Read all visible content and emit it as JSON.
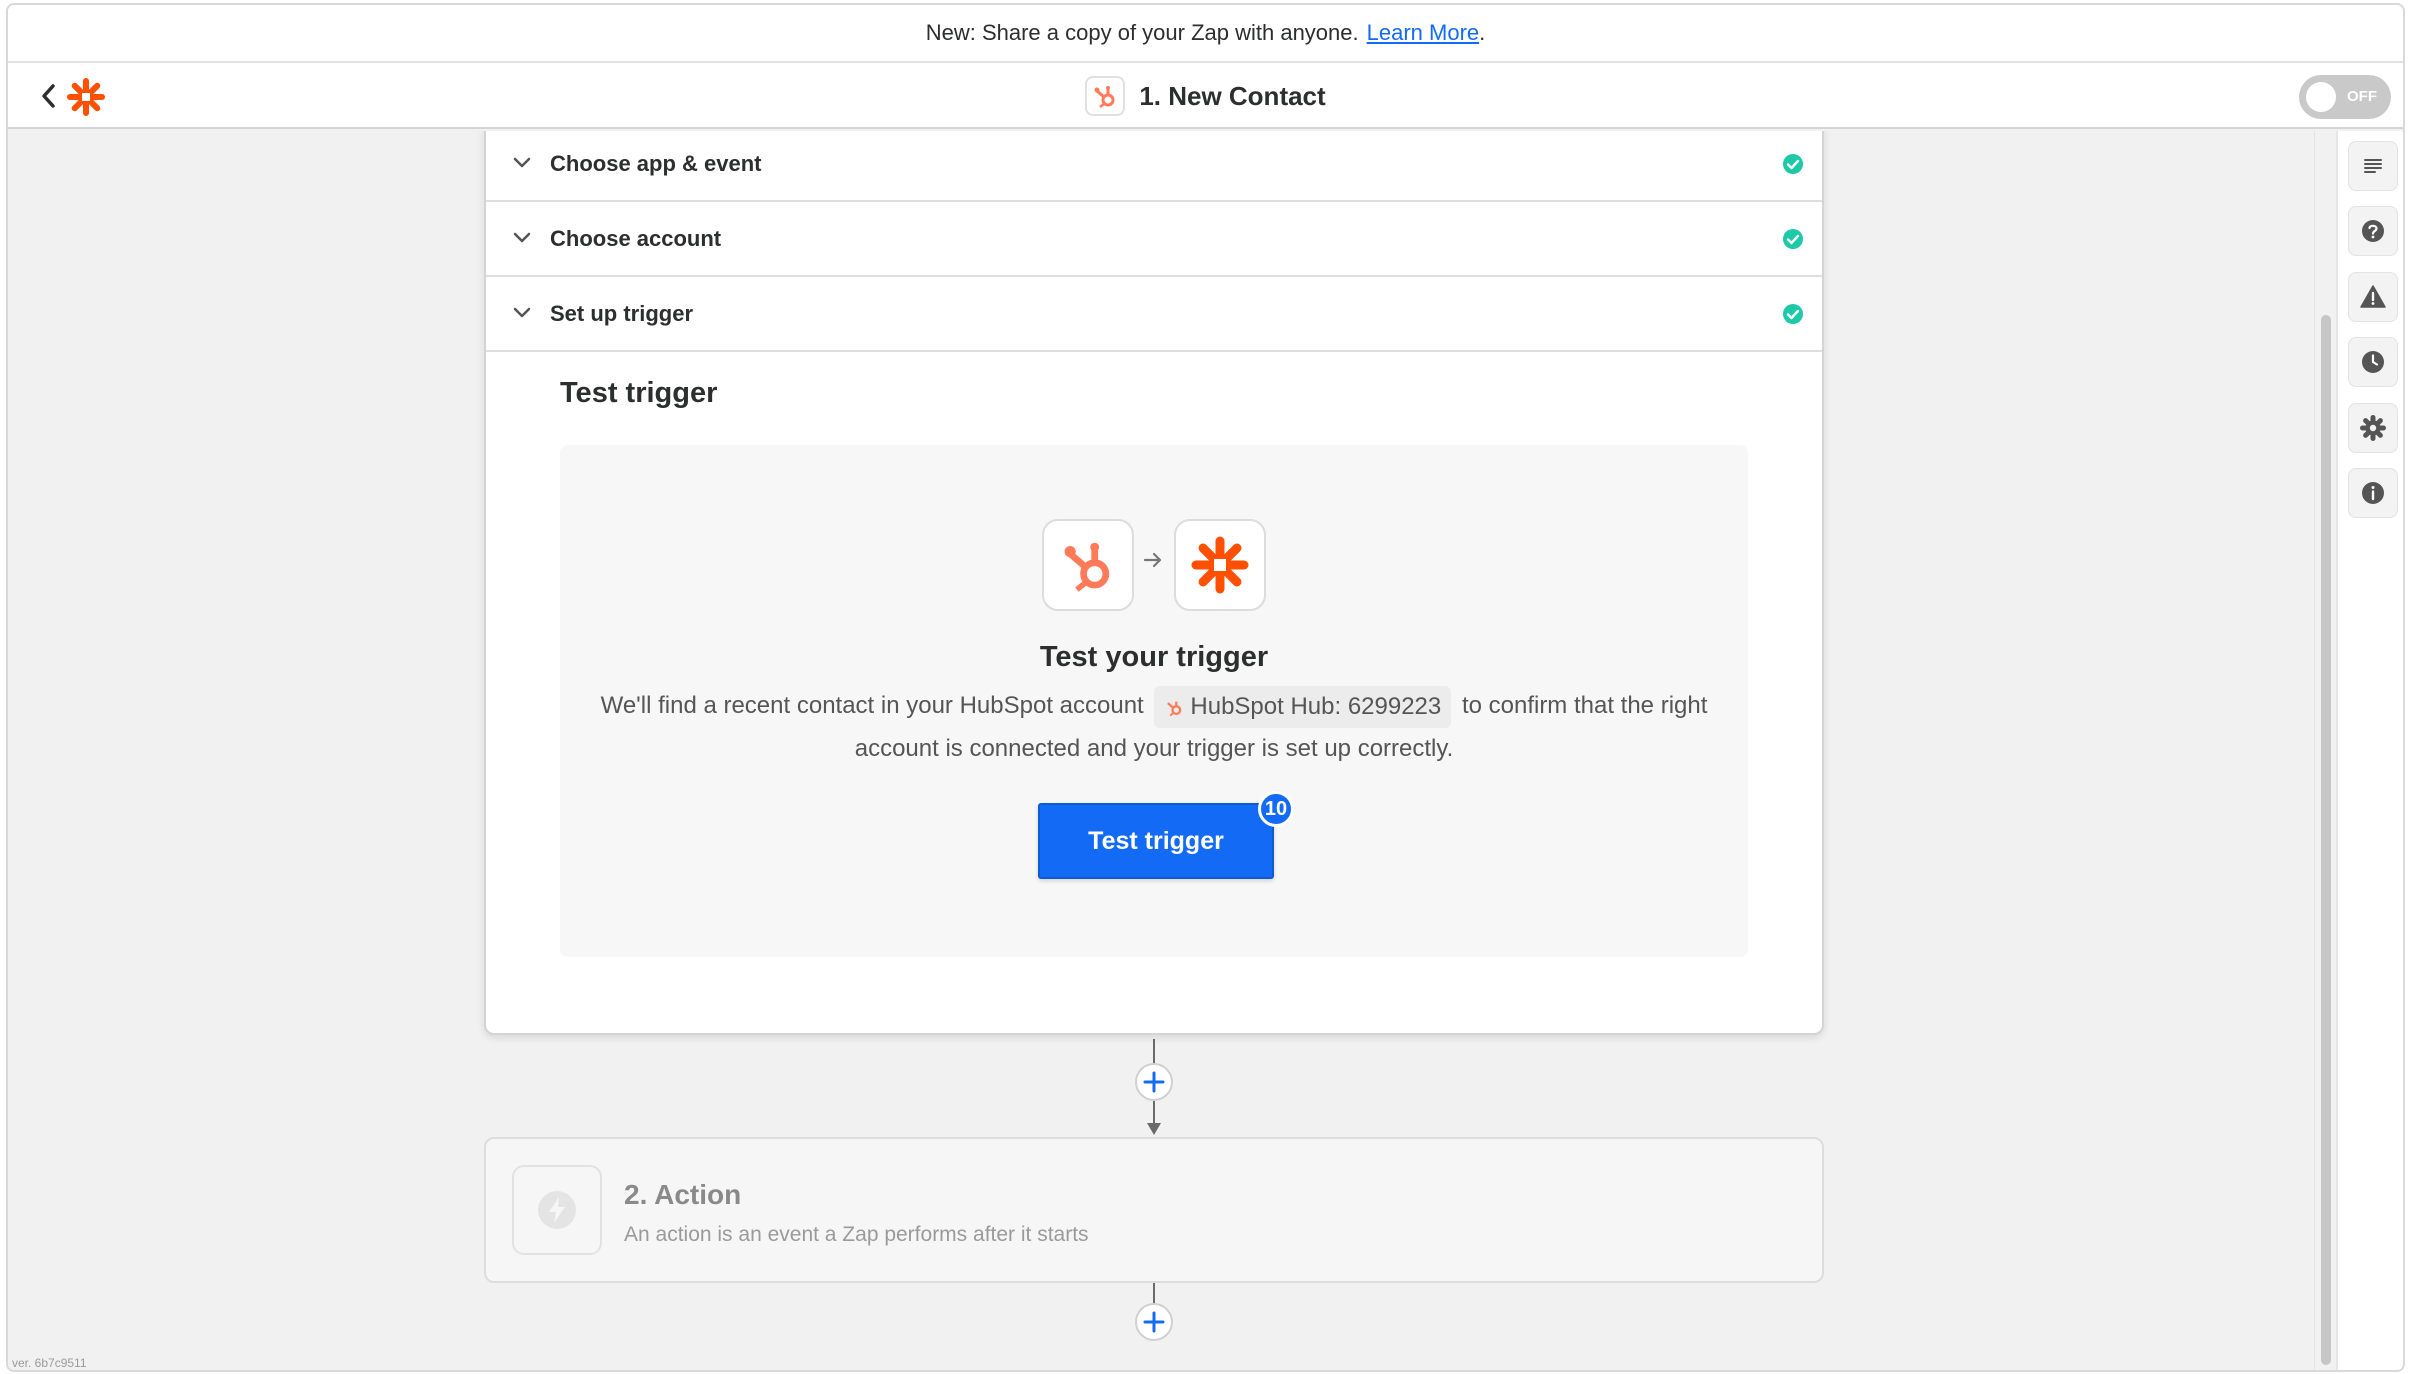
{
  "banner": {
    "text": "New: Share a copy of your Zap with anyone.",
    "link": "Learn More",
    "suffix": "."
  },
  "header": {
    "title": "1. New Contact",
    "toggle_label": "OFF"
  },
  "accordion": [
    {
      "label": "Choose app & event",
      "status": "complete"
    },
    {
      "label": "Choose account",
      "status": "complete"
    },
    {
      "label": "Set up trigger",
      "status": "complete"
    }
  ],
  "test": {
    "heading": "Test trigger",
    "panel_title": "Test your trigger",
    "desc_before": "We'll find a recent contact in your HubSpot account",
    "chip": "HubSpot Hub: 6299223",
    "desc_after": "to confirm that the right account is connected and your trigger is set up correctly.",
    "button": "Test trigger",
    "badge": "10"
  },
  "action": {
    "title": "2. Action",
    "subtitle": "An action is an event a Zap performs after it starts"
  },
  "version": "ver. 6b7c9511",
  "sidebar_icons": [
    "outline-icon",
    "help-icon",
    "warning-icon",
    "history-icon",
    "settings-icon",
    "info-icon"
  ],
  "colors": {
    "accent": "#136bf5",
    "hubspot": "#ff7a59",
    "zapier": "#ff4f00",
    "success": "#1dc9a8"
  }
}
